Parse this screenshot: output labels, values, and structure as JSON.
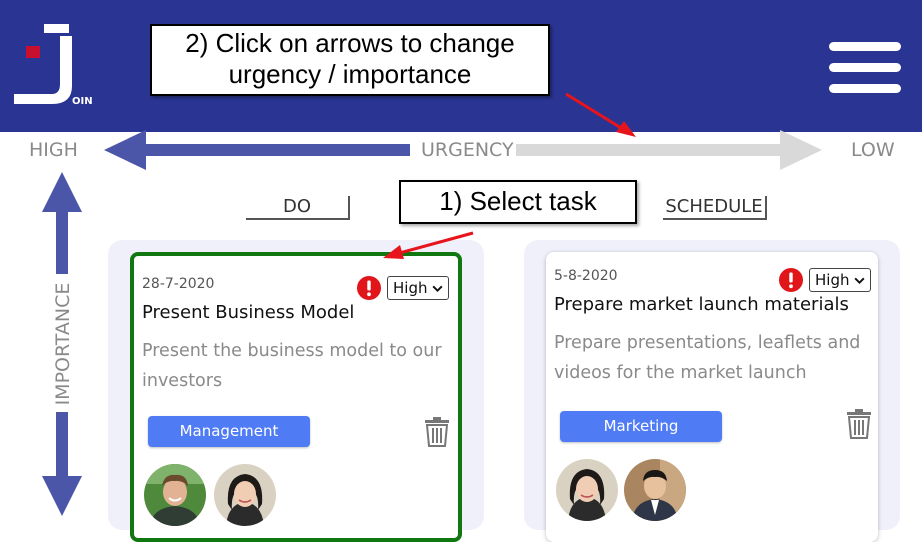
{
  "app": {
    "logo_letters": "OIN"
  },
  "callouts": {
    "step2_line1": "2) Click on arrows to change",
    "step2_line2": "urgency / importance",
    "step1": "1) Select task"
  },
  "axes": {
    "urgency_high": "HIGH",
    "urgency_low": "LOW",
    "urgency_label": "URGENCY",
    "importance_label": "IMPORTANCE"
  },
  "quadrants": {
    "do": "DO",
    "schedule": "SCHEDULE"
  },
  "tasks": [
    {
      "date": "28-7-2020",
      "title": "Present Business Model",
      "description": "Present the business model to our investors",
      "priority": "High",
      "category": "Management",
      "category_color": "#4f7bf5",
      "selected": true
    },
    {
      "date": "5-8-2020",
      "title": "Prepare market launch materials",
      "description": "Prepare presentations, leaflets and videos for the market launch",
      "priority": "High",
      "category": "Marketing",
      "category_color": "#4f7bf5",
      "selected": false
    }
  ],
  "colors": {
    "header": "#2a3593",
    "arrow_active": "#4b56a8",
    "arrow_inactive": "#d9d9d9",
    "selected_border": "#117711",
    "urgent": "#e0161b"
  }
}
